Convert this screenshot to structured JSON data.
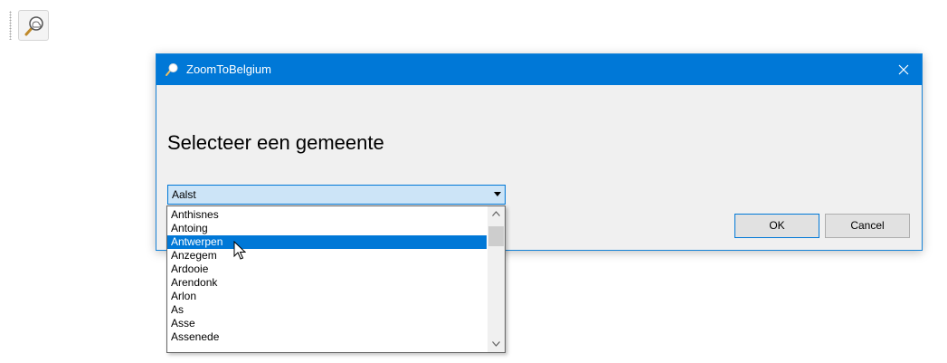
{
  "toolbar": {
    "button_icon": "zoom-magnifier-icon"
  },
  "dialog": {
    "title": "ZoomToBelgium",
    "title_icon": "zoom-magnifier-icon",
    "close_icon": "close-icon",
    "heading": "Selecteer een gemeente",
    "combo_value": "Aalst",
    "ok_label": "OK",
    "cancel_label": "Cancel"
  },
  "dropdown": {
    "items": [
      "Anthisnes",
      "Antoing",
      "Antwerpen",
      "Anzegem",
      "Ardooie",
      "Arendonk",
      "Arlon",
      "As",
      "Asse",
      "Assenede"
    ],
    "selected": "Antwerpen"
  },
  "colors": {
    "accent": "#0078d7",
    "dialog_bg": "#f0f0f0",
    "combo_bg": "#cce4f7"
  }
}
